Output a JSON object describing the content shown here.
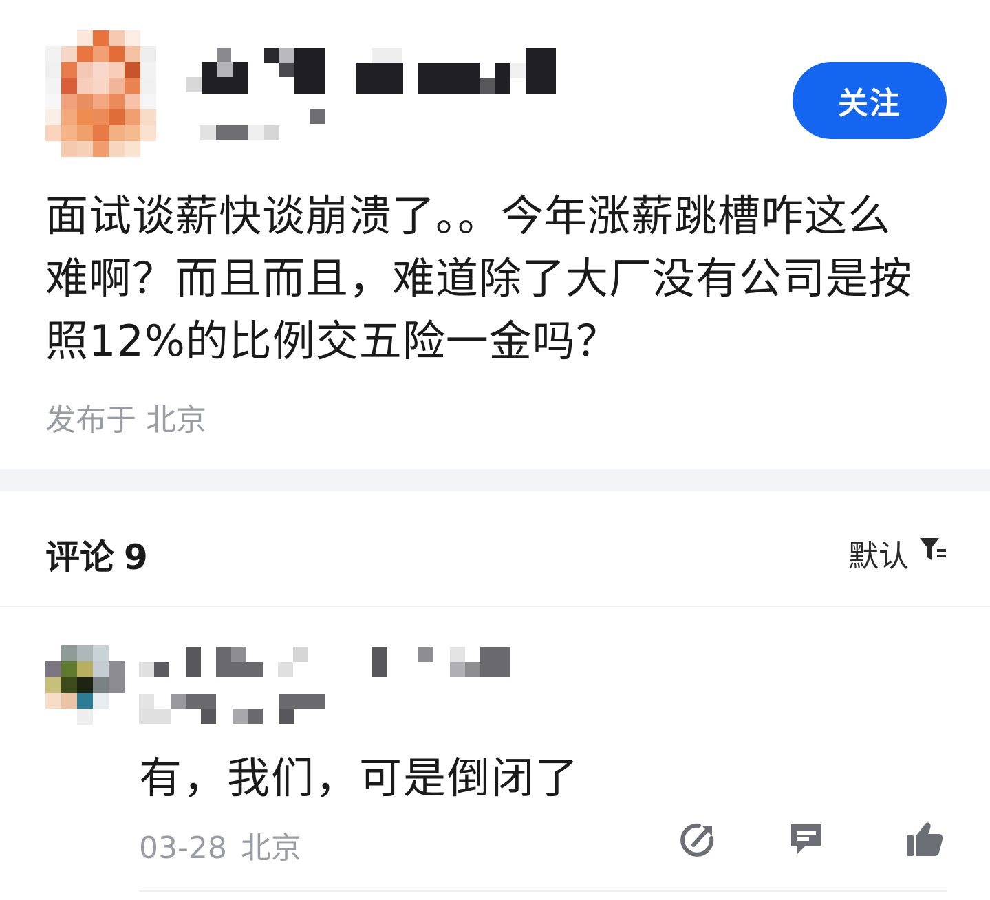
{
  "post": {
    "follow_label": "关注",
    "content": "面试谈薪快谈崩溃了。。今年涨薪跳槽咋这么难啊？而且而且，难道除了大厂没有公司是按照12%的比例交五险一金吗？",
    "location": "发布于 北京"
  },
  "comments_section": {
    "title": "评论",
    "count": "9",
    "sort_label": "默认"
  },
  "comments": [
    {
      "text": "有，我们，可是倒闭了",
      "date": "03-28",
      "location": "北京"
    }
  ],
  "colors": {
    "accent": "#1466f0",
    "muted_text": "#9a9ca3",
    "divider": "#f3f4f6",
    "icon": "#6b6e75"
  },
  "icons": [
    "share-icon",
    "reply-icon",
    "thumbs-up-icon",
    "filter-icon"
  ]
}
